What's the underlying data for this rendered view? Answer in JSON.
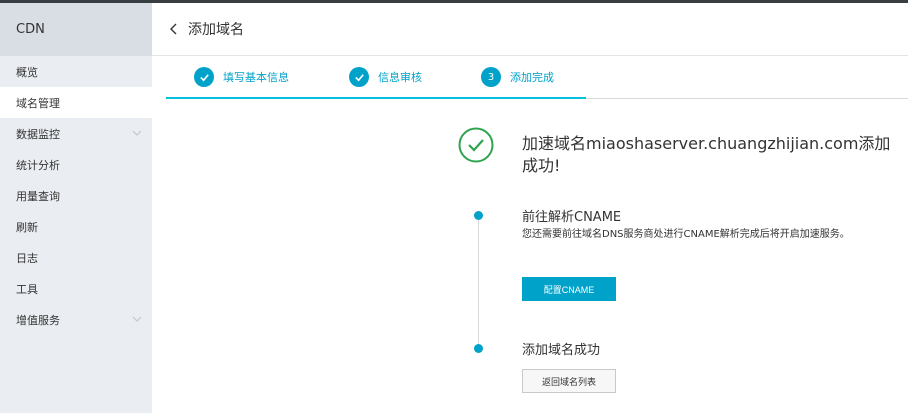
{
  "sidebar": {
    "title": "CDN",
    "items": [
      {
        "label": "概览",
        "active": false,
        "expandable": false
      },
      {
        "label": "域名管理",
        "active": true,
        "expandable": false
      },
      {
        "label": "数据监控",
        "active": false,
        "expandable": true
      },
      {
        "label": "统计分析",
        "active": false,
        "expandable": false
      },
      {
        "label": "用量查询",
        "active": false,
        "expandable": false
      },
      {
        "label": "刷新",
        "active": false,
        "expandable": false
      },
      {
        "label": "日志",
        "active": false,
        "expandable": false
      },
      {
        "label": "工具",
        "active": false,
        "expandable": false
      },
      {
        "label": "增值服务",
        "active": false,
        "expandable": true
      }
    ]
  },
  "header": {
    "title": "添加域名"
  },
  "steps": [
    {
      "label": "填写基本信息",
      "state": "done"
    },
    {
      "label": "信息审核",
      "state": "done"
    },
    {
      "number": "3",
      "label": "添加完成",
      "state": "current"
    }
  ],
  "result": {
    "title": "加速域名miaoshaserver.chuangzhijian.com添加成功!",
    "step1_title": "前往解析CNAME",
    "step1_desc": "您还需要前往域名DNS服务商处进行CNAME解析完成后将开启加速服务。",
    "step1_button": "配置CNAME",
    "step2_title": "添加域名成功",
    "step2_button": "返回域名列表"
  },
  "colors": {
    "accent": "#00a2ca",
    "success": "#2ea44f",
    "sidebar_bg": "#eaedf1"
  }
}
